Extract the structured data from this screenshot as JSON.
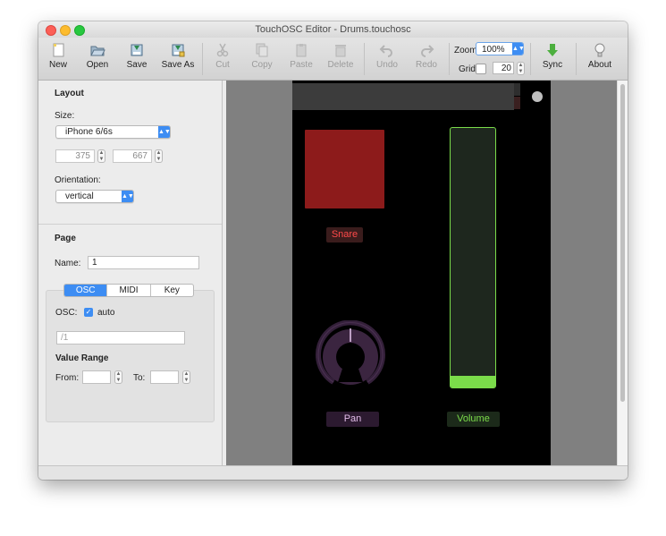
{
  "window": {
    "title": "TouchOSC Editor - Drums.touchosc"
  },
  "toolbar": {
    "buttons": [
      {
        "label": "New",
        "icon": "new-document-icon",
        "enabled": true
      },
      {
        "label": "Open",
        "icon": "open-folder-icon",
        "enabled": true
      },
      {
        "label": "Save",
        "icon": "save-icon",
        "enabled": true
      },
      {
        "label": "Save As",
        "icon": "save-as-icon",
        "enabled": true
      },
      {
        "label": "Cut",
        "icon": "scissors-icon",
        "enabled": false
      },
      {
        "label": "Copy",
        "icon": "copy-icon",
        "enabled": false
      },
      {
        "label": "Paste",
        "icon": "clipboard-icon",
        "enabled": false
      },
      {
        "label": "Delete",
        "icon": "trash-icon",
        "enabled": false
      },
      {
        "label": "Undo",
        "icon": "undo-arrow-icon",
        "enabled": false
      },
      {
        "label": "Redo",
        "icon": "redo-arrow-icon",
        "enabled": false
      },
      {
        "label": "Sync",
        "icon": "sync-arrow-icon",
        "enabled": true
      },
      {
        "label": "About",
        "icon": "lightbulb-icon",
        "enabled": true
      }
    ],
    "zoom_label": "Zoom",
    "zoom_value": "100%",
    "grid_label": "Grid",
    "grid_checked": false,
    "grid_size": "20"
  },
  "layout": {
    "heading": "Layout",
    "size_label": "Size:",
    "size_value": "iPhone 6/6s",
    "width": "375",
    "height": "667",
    "orientation_label": "Orientation:",
    "orientation_value": "vertical"
  },
  "page": {
    "heading": "Page",
    "name_label": "Name:",
    "name_value": "1",
    "tabs": [
      {
        "label": "OSC",
        "selected": true
      },
      {
        "label": "MIDI",
        "selected": false
      },
      {
        "label": "Key",
        "selected": false
      }
    ],
    "osc_label": "OSC:",
    "auto_label": "auto",
    "auto_checked": true,
    "osc_address_placeholder": "/1",
    "value_range_label": "Value Range",
    "from_label": "From:",
    "to_label": "To:",
    "from_value": "",
    "to_value": ""
  },
  "controls": {
    "pad_label": "Snare",
    "knob_label": "Pan",
    "fader_label": "Volume",
    "fader_level": 0.05,
    "colors": {
      "pad": "#8d1b1b",
      "pad_label_text": "#ff4a4a",
      "knob": "#c79ccf",
      "fader": "#7bdc4a"
    }
  }
}
